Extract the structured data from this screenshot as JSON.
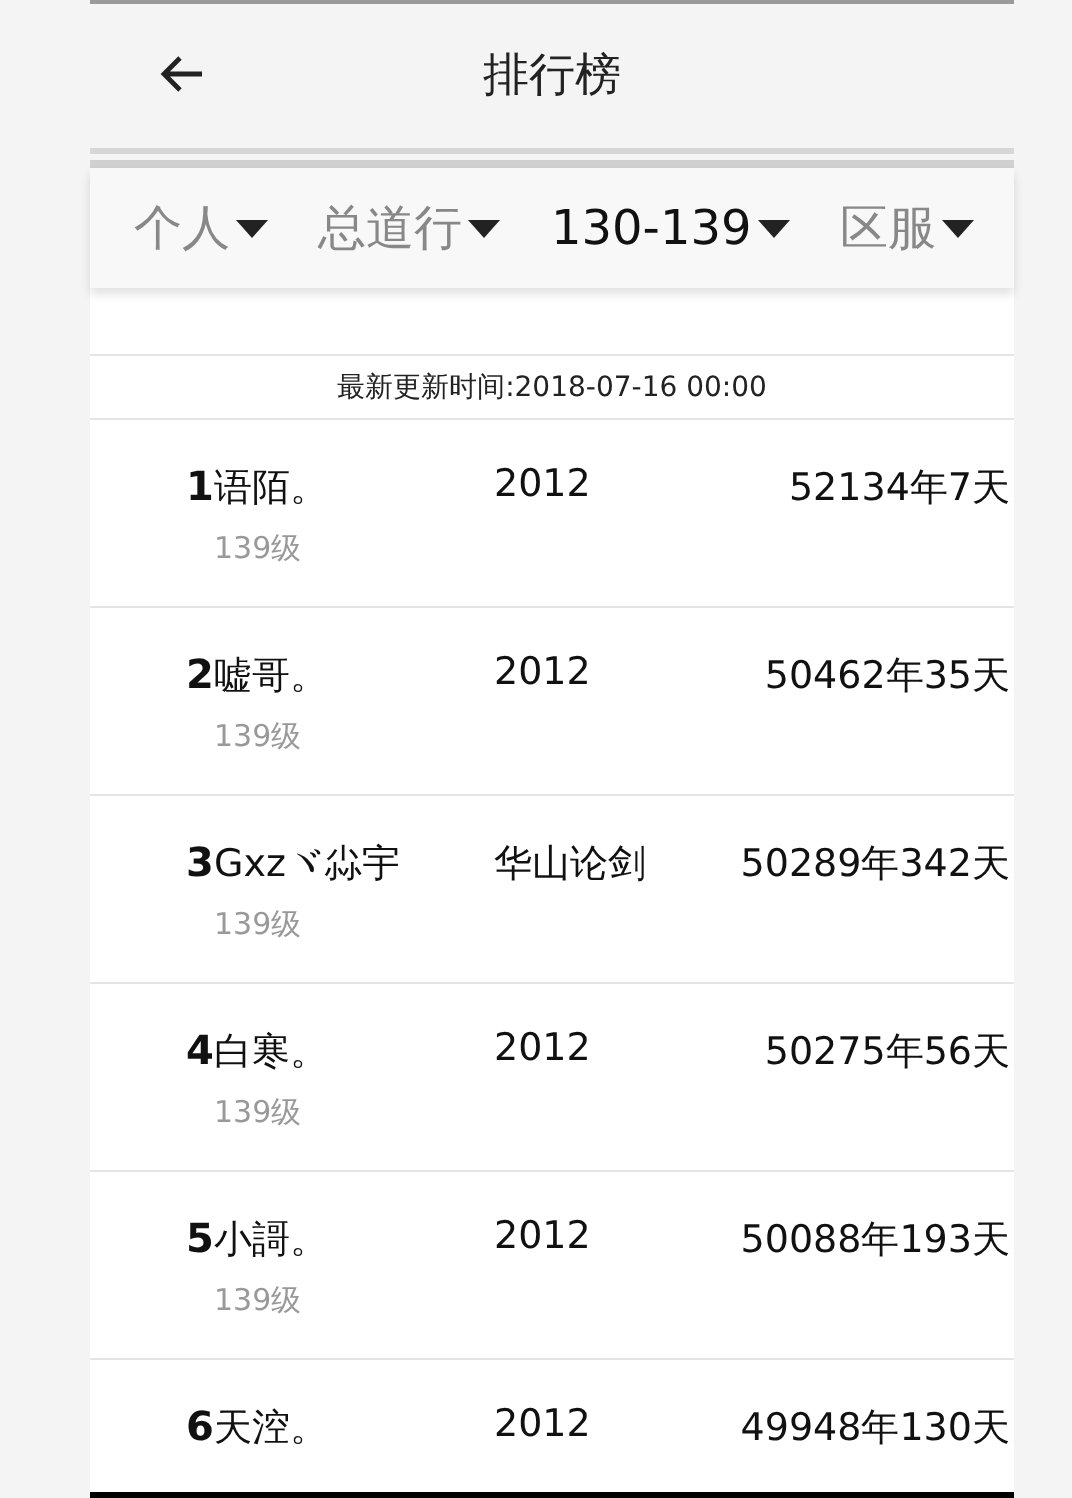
{
  "header": {
    "title": "排行榜"
  },
  "filters": [
    {
      "label": "个人",
      "selected": false
    },
    {
      "label": "总道行",
      "selected": false
    },
    {
      "label": "130-139",
      "selected": true
    },
    {
      "label": "区服",
      "selected": false
    }
  ],
  "update_time": "最新更新时间:2018-07-16 00:00",
  "rows": [
    {
      "rank": "1",
      "name": "语陌。",
      "level": "139级",
      "column_3": "2012",
      "value": "52134年7天"
    },
    {
      "rank": "2",
      "name": "嘘哥。",
      "level": "139级",
      "column_3": "2012",
      "value": "50462年35天"
    },
    {
      "rank": "3",
      "name": "Gxzヾ尛宇",
      "level": "139级",
      "column_3": "华山论剑",
      "value": "50289年342天"
    },
    {
      "rank": "4",
      "name": "白寒。",
      "level": "139级",
      "column_3": "2012",
      "value": "50275年56天"
    },
    {
      "rank": "5",
      "name": "小謌。",
      "level": "139级",
      "column_3": "2012",
      "value": "50088年193天"
    },
    {
      "rank": "6",
      "name": "天涳。",
      "column_3": "2012",
      "value": "49948年130天"
    }
  ]
}
